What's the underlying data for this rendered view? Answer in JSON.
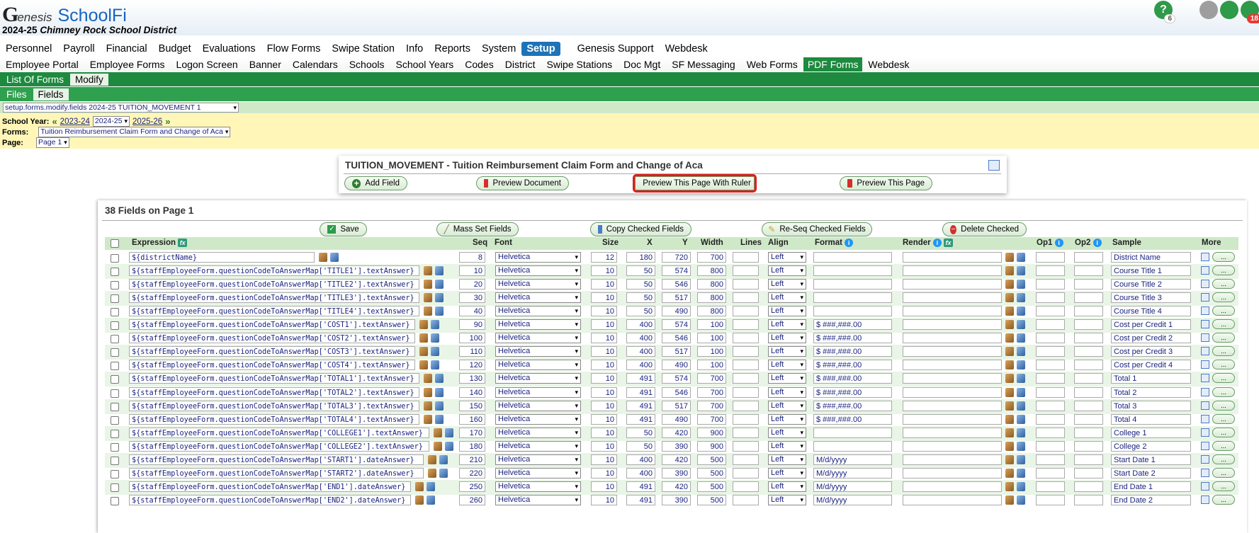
{
  "app": {
    "logo_g": "G",
    "logo_rest": "enesis",
    "name": "SchoolFi",
    "year": "2024-25",
    "district": "Chimney Rock School District"
  },
  "top_icons": [
    {
      "name": "help-icon",
      "glyph": "?",
      "color": "#2e9a4a",
      "badge": "6"
    },
    {
      "name": "binoculars-icon",
      "glyph": "",
      "color": "#444"
    },
    {
      "name": "gear-icon",
      "glyph": "",
      "color": "#9e9e9e"
    },
    {
      "name": "headset-icon",
      "glyph": "",
      "color": "#2e9a4a"
    },
    {
      "name": "mail-icon",
      "glyph": "",
      "color": "#2e9a4a",
      "badge": "18"
    }
  ],
  "nav": [
    "Personnel",
    "Payroll",
    "Financial",
    "Budget",
    "Evaluations",
    "Flow Forms",
    "Swipe Station",
    "Info",
    "Reports",
    "System",
    "Setup",
    "Genesis Support",
    "Webdesk"
  ],
  "nav_active": "Setup",
  "subnav": [
    "Employee Portal",
    "Employee Forms",
    "Logon Screen",
    "Banner",
    "Calendars",
    "Schools",
    "School Years",
    "Codes",
    "District",
    "Swipe Stations",
    "Doc Mgt",
    "SF Messaging",
    "Web Forms",
    "PDF Forms",
    "Webdesk"
  ],
  "subnav_active": "PDF Forms",
  "tabs1": [
    "List Of Forms",
    "Modify"
  ],
  "tabs1_active": "Modify",
  "tabs2": [
    "Files",
    "Fields"
  ],
  "tabs2_active": "Fields",
  "path_select": "setup.forms.modify.fields 2024-25 TUITION_MOVEMENT 1",
  "selectors": {
    "school_year_label": "School Year:",
    "prev_year": "2023-24",
    "current_year": "2024-25",
    "next_year": "2025-26",
    "forms_label": "Forms:",
    "form": "Tuition Reimbursement Claim Form and Change of Aca",
    "page_label": "Page:",
    "page": "Page 1"
  },
  "form_box": {
    "title": "TUITION_MOVEMENT - Tuition Reimbursement Claim Form and Change of Aca",
    "add_field": "Add Field",
    "preview_document": "Preview Document",
    "preview_ruler": "Preview This Page With Ruler",
    "preview_page": "Preview This Page"
  },
  "fields_panel": {
    "title": "38 Fields on Page 1",
    "buttons": {
      "save": "Save",
      "mass_set": "Mass Set Fields",
      "copy": "Copy Checked Fields",
      "reseq": "Re-Seq Checked Fields",
      "delete": "Delete Checked"
    },
    "headers": {
      "expression": "Expression",
      "seq": "Seq",
      "font": "Font",
      "size": "Size",
      "x": "X",
      "y": "Y",
      "width": "Width",
      "lines": "Lines",
      "align": "Align",
      "format": "Format",
      "render": "Render",
      "op1": "Op1",
      "op2": "Op2",
      "sample": "Sample",
      "more": "More"
    },
    "rows": [
      {
        "expr": "${districtName}",
        "seq": "8",
        "font": "Helvetica",
        "size": "12",
        "x": "180",
        "y": "720",
        "width": "700",
        "align": "Left",
        "format": "",
        "sample": "District Name",
        "ew": 262
      },
      {
        "expr": "${staffEmployeeForm.questionCodeToAnswerMap['TITLE1'].textAnswer}",
        "seq": "10",
        "font": "Helvetica",
        "size": "10",
        "x": "50",
        "y": "574",
        "width": "800",
        "align": "Left",
        "format": "",
        "sample": "Course Title 1",
        "ew": 410
      },
      {
        "expr": "${staffEmployeeForm.questionCodeToAnswerMap['TITLE2'].textAnswer}",
        "seq": "20",
        "font": "Helvetica",
        "size": "10",
        "x": "50",
        "y": "546",
        "width": "800",
        "align": "Left",
        "format": "",
        "sample": "Course Title 2",
        "ew": 410
      },
      {
        "expr": "${staffEmployeeForm.questionCodeToAnswerMap['TITLE3'].textAnswer}",
        "seq": "30",
        "font": "Helvetica",
        "size": "10",
        "x": "50",
        "y": "517",
        "width": "800",
        "align": "Left",
        "format": "",
        "sample": "Course Title 3",
        "ew": 410
      },
      {
        "expr": "${staffEmployeeForm.questionCodeToAnswerMap['TITLE4'].textAnswer}",
        "seq": "40",
        "font": "Helvetica",
        "size": "10",
        "x": "50",
        "y": "490",
        "width": "800",
        "align": "Left",
        "format": "",
        "sample": "Course Title 4",
        "ew": 410
      },
      {
        "expr": "${staffEmployeeForm.questionCodeToAnswerMap['COST1'].textAnswer}",
        "seq": "90",
        "font": "Helvetica",
        "size": "10",
        "x": "400",
        "y": "574",
        "width": "100",
        "align": "Left",
        "format": "$ ###,###.00",
        "sample": "Cost per Credit 1",
        "ew": 404
      },
      {
        "expr": "${staffEmployeeForm.questionCodeToAnswerMap['COST2'].textAnswer}",
        "seq": "100",
        "font": "Helvetica",
        "size": "10",
        "x": "400",
        "y": "546",
        "width": "100",
        "align": "Left",
        "format": "$ ###,###.00",
        "sample": "Cost per Credit 2",
        "ew": 404
      },
      {
        "expr": "${staffEmployeeForm.questionCodeToAnswerMap['COST3'].textAnswer}",
        "seq": "110",
        "font": "Helvetica",
        "size": "10",
        "x": "400",
        "y": "517",
        "width": "100",
        "align": "Left",
        "format": "$ ###,###.00",
        "sample": "Cost per Credit 3",
        "ew": 404
      },
      {
        "expr": "${staffEmployeeForm.questionCodeToAnswerMap['COST4'].textAnswer}",
        "seq": "120",
        "font": "Helvetica",
        "size": "10",
        "x": "400",
        "y": "490",
        "width": "100",
        "align": "Left",
        "format": "$ ###,###.00",
        "sample": "Cost per Credit 4",
        "ew": 404
      },
      {
        "expr": "${staffEmployeeForm.questionCodeToAnswerMap['TOTAL1'].textAnswer}",
        "seq": "130",
        "font": "Helvetica",
        "size": "10",
        "x": "491",
        "y": "574",
        "width": "700",
        "align": "Left",
        "format": "$ ###,###.00",
        "sample": "Total 1",
        "ew": 410
      },
      {
        "expr": "${staffEmployeeForm.questionCodeToAnswerMap['TOTAL2'].textAnswer}",
        "seq": "140",
        "font": "Helvetica",
        "size": "10",
        "x": "491",
        "y": "546",
        "width": "700",
        "align": "Left",
        "format": "$ ###,###.00",
        "sample": "Total 2",
        "ew": 410
      },
      {
        "expr": "${staffEmployeeForm.questionCodeToAnswerMap['TOTAL3'].textAnswer}",
        "seq": "150",
        "font": "Helvetica",
        "size": "10",
        "x": "491",
        "y": "517",
        "width": "700",
        "align": "Left",
        "format": "$ ###,###.00",
        "sample": "Total 3",
        "ew": 410
      },
      {
        "expr": "${staffEmployeeForm.questionCodeToAnswerMap['TOTAL4'].textAnswer}",
        "seq": "160",
        "font": "Helvetica",
        "size": "10",
        "x": "491",
        "y": "490",
        "width": "700",
        "align": "Left",
        "format": "$ ###,###.00",
        "sample": "Total 4",
        "ew": 410
      },
      {
        "expr": "${staffEmployeeForm.questionCodeToAnswerMap['COLLEGE1'].textAnswer}",
        "seq": "170",
        "font": "Helvetica",
        "size": "10",
        "x": "50",
        "y": "420",
        "width": "900",
        "align": "Left",
        "format": "",
        "sample": "College 1",
        "ew": 424
      },
      {
        "expr": "${staffEmployeeForm.questionCodeToAnswerMap['COLLEGE2'].textAnswer}",
        "seq": "180",
        "font": "Helvetica",
        "size": "10",
        "x": "50",
        "y": "390",
        "width": "900",
        "align": "Left",
        "format": "",
        "sample": "College 2",
        "ew": 424
      },
      {
        "expr": "${staffEmployeeForm.questionCodeToAnswerMap['START1'].dateAnswer}",
        "seq": "210",
        "font": "Helvetica",
        "size": "10",
        "x": "400",
        "y": "420",
        "width": "500",
        "align": "Left",
        "format": "M/d/yyyy",
        "sample": "Start Date 1",
        "ew": 416
      },
      {
        "expr": "${staffEmployeeForm.questionCodeToAnswerMap['START2'].dateAnswer}",
        "seq": "220",
        "font": "Helvetica",
        "size": "10",
        "x": "400",
        "y": "390",
        "width": "500",
        "align": "Left",
        "format": "M/d/yyyy",
        "sample": "Start Date 2",
        "ew": 416
      },
      {
        "expr": "${staffEmployeeForm.questionCodeToAnswerMap['END1'].dateAnswer}",
        "seq": "250",
        "font": "Helvetica",
        "size": "10",
        "x": "491",
        "y": "420",
        "width": "500",
        "align": "Left",
        "format": "M/d/yyyy",
        "sample": "End Date 1",
        "ew": 398
      },
      {
        "expr": "${staffEmployeeForm.questionCodeToAnswerMap['END2'].dateAnswer}",
        "seq": "260",
        "font": "Helvetica",
        "size": "10",
        "x": "491",
        "y": "390",
        "width": "500",
        "align": "Left",
        "format": "M/d/yyyy",
        "sample": "End Date 2",
        "ew": 398
      }
    ]
  }
}
